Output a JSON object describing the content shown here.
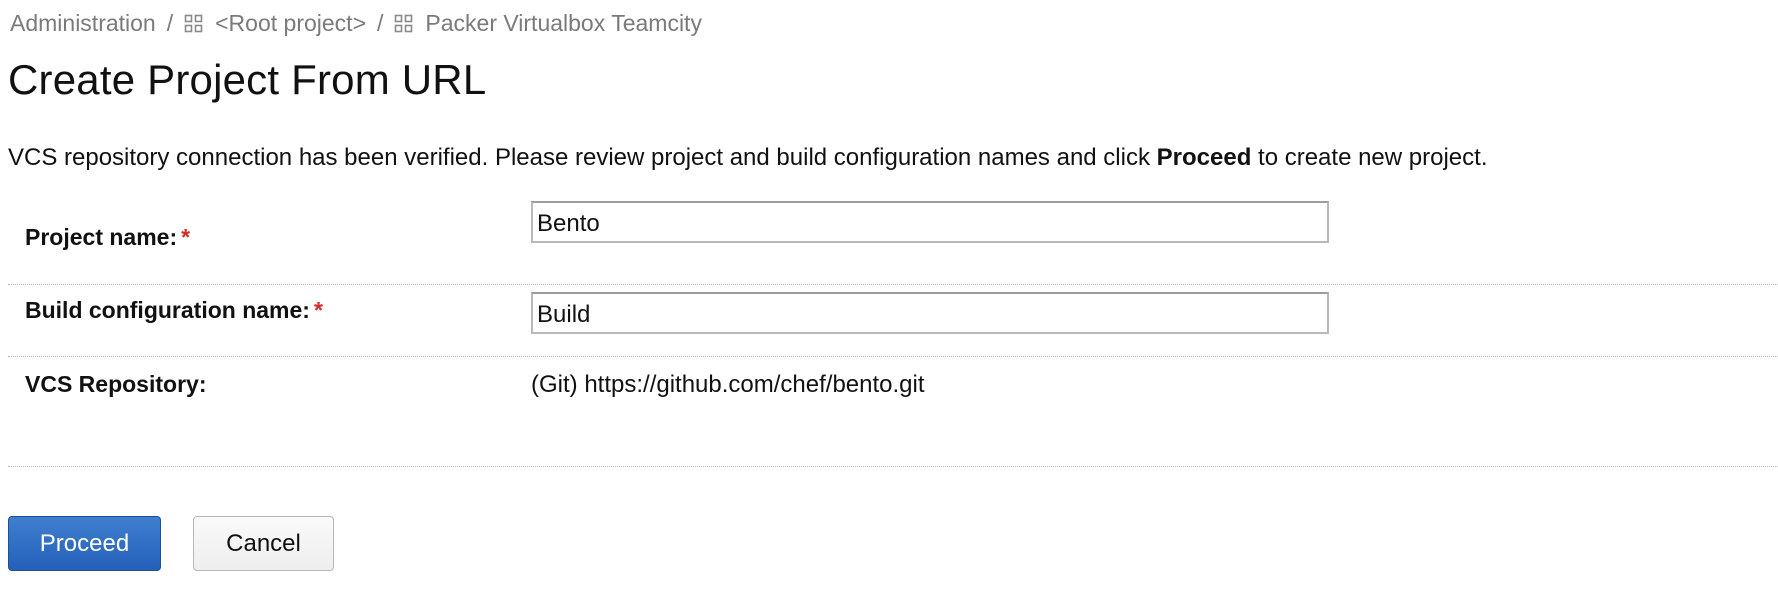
{
  "breadcrumb": {
    "items": [
      {
        "label": "Administration"
      },
      {
        "label": "<Root project>",
        "icon": "project-grid-icon"
      },
      {
        "label": "Packer Virtualbox Teamcity",
        "icon": "project-grid-icon"
      }
    ],
    "separator": "/"
  },
  "page": {
    "title": "Create Project From URL",
    "intro_before": "VCS repository connection has been verified. Please review project and build configuration names and click ",
    "intro_strong": "Proceed",
    "intro_after": " to create new project."
  },
  "form": {
    "project_name": {
      "label": "Project name:",
      "required_mark": "*",
      "value": "Bento"
    },
    "build_configuration_name": {
      "label": "Build configuration name:",
      "required_mark": "*",
      "value": "Build"
    },
    "vcs_repository": {
      "label": "VCS Repository:",
      "value": "(Git) https://github.com/chef/bento.git"
    }
  },
  "actions": {
    "proceed_label": "Proceed",
    "cancel_label": "Cancel"
  },
  "colors": {
    "primary_button": "#2f6fc6",
    "required_asterisk": "#d62a2a",
    "breadcrumb_text": "#7a7a7a",
    "divider": "#b8b8b8"
  }
}
